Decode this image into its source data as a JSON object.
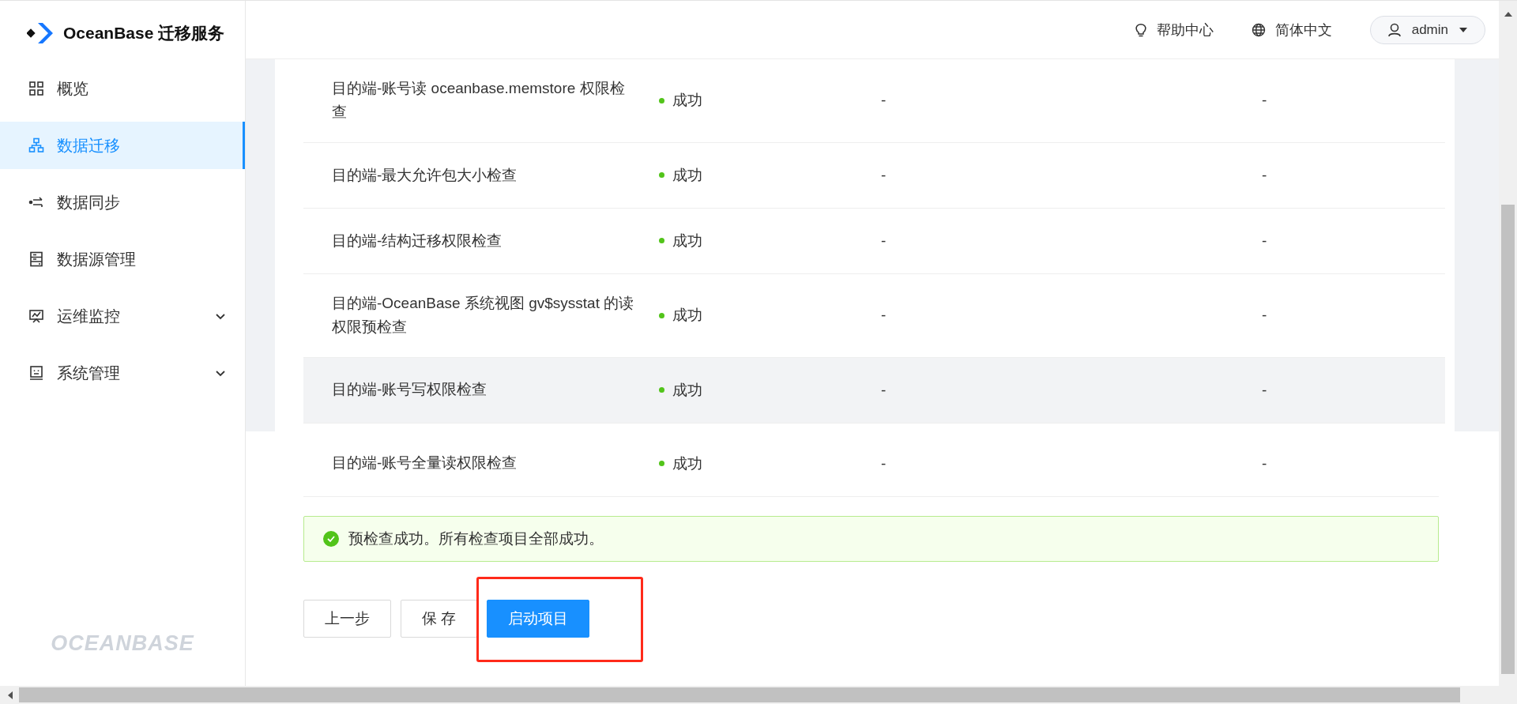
{
  "sidebar": {
    "logo": {
      "text": "OceanBase 迁移服务"
    },
    "items": [
      {
        "label": "概览",
        "kind": "link",
        "selected": false
      },
      {
        "label": "数据迁移",
        "kind": "link",
        "selected": true
      },
      {
        "label": "数据同步",
        "kind": "link",
        "selected": false
      },
      {
        "label": "数据源管理",
        "kind": "link",
        "selected": false
      },
      {
        "label": "运维监控",
        "kind": "submenu",
        "expanded": false,
        "selected": false
      },
      {
        "label": "系统管理",
        "kind": "submenu",
        "expanded": false,
        "selected": false
      }
    ],
    "footer_logo": "OCEANBASE"
  },
  "header": {
    "help": "帮助中心",
    "language": "简体中文",
    "user": "admin"
  },
  "table": {
    "rows": [
      {
        "name": "目的端-账号读 oceanbase.memstore 权限检查",
        "status": "成功",
        "column_3": "-",
        "column_4": "-",
        "hovered": false
      },
      {
        "name": "目的端-最大允许包大小检查",
        "status": "成功",
        "column_3": "-",
        "column_4": "-",
        "hovered": false
      },
      {
        "name": "目的端-结构迁移权限检查",
        "status": "成功",
        "column_3": "-",
        "column_4": "-",
        "hovered": false
      },
      {
        "name": "目的端-OceanBase 系统视图 gv$sysstat 的读权限预检查",
        "status": "成功",
        "column_3": "-",
        "column_4": "-",
        "hovered": false
      },
      {
        "name": "目的端-账号写权限检查",
        "status": "成功",
        "column_3": "-",
        "column_4": "-",
        "hovered": true
      },
      {
        "name": "目的端-账号全量读权限检查",
        "status": "成功",
        "column_3": "-",
        "column_4": "-",
        "hovered": false
      }
    ]
  },
  "alert": {
    "kind": "success",
    "text": "预检查成功。所有检查项目全部成功。"
  },
  "buttons": [
    {
      "label": "上一步",
      "kind": "default",
      "highlighted": false
    },
    {
      "label": "保 存",
      "kind": "default",
      "highlighted": false
    },
    {
      "label": "启动项目",
      "kind": "primary",
      "highlighted": true
    }
  ]
}
